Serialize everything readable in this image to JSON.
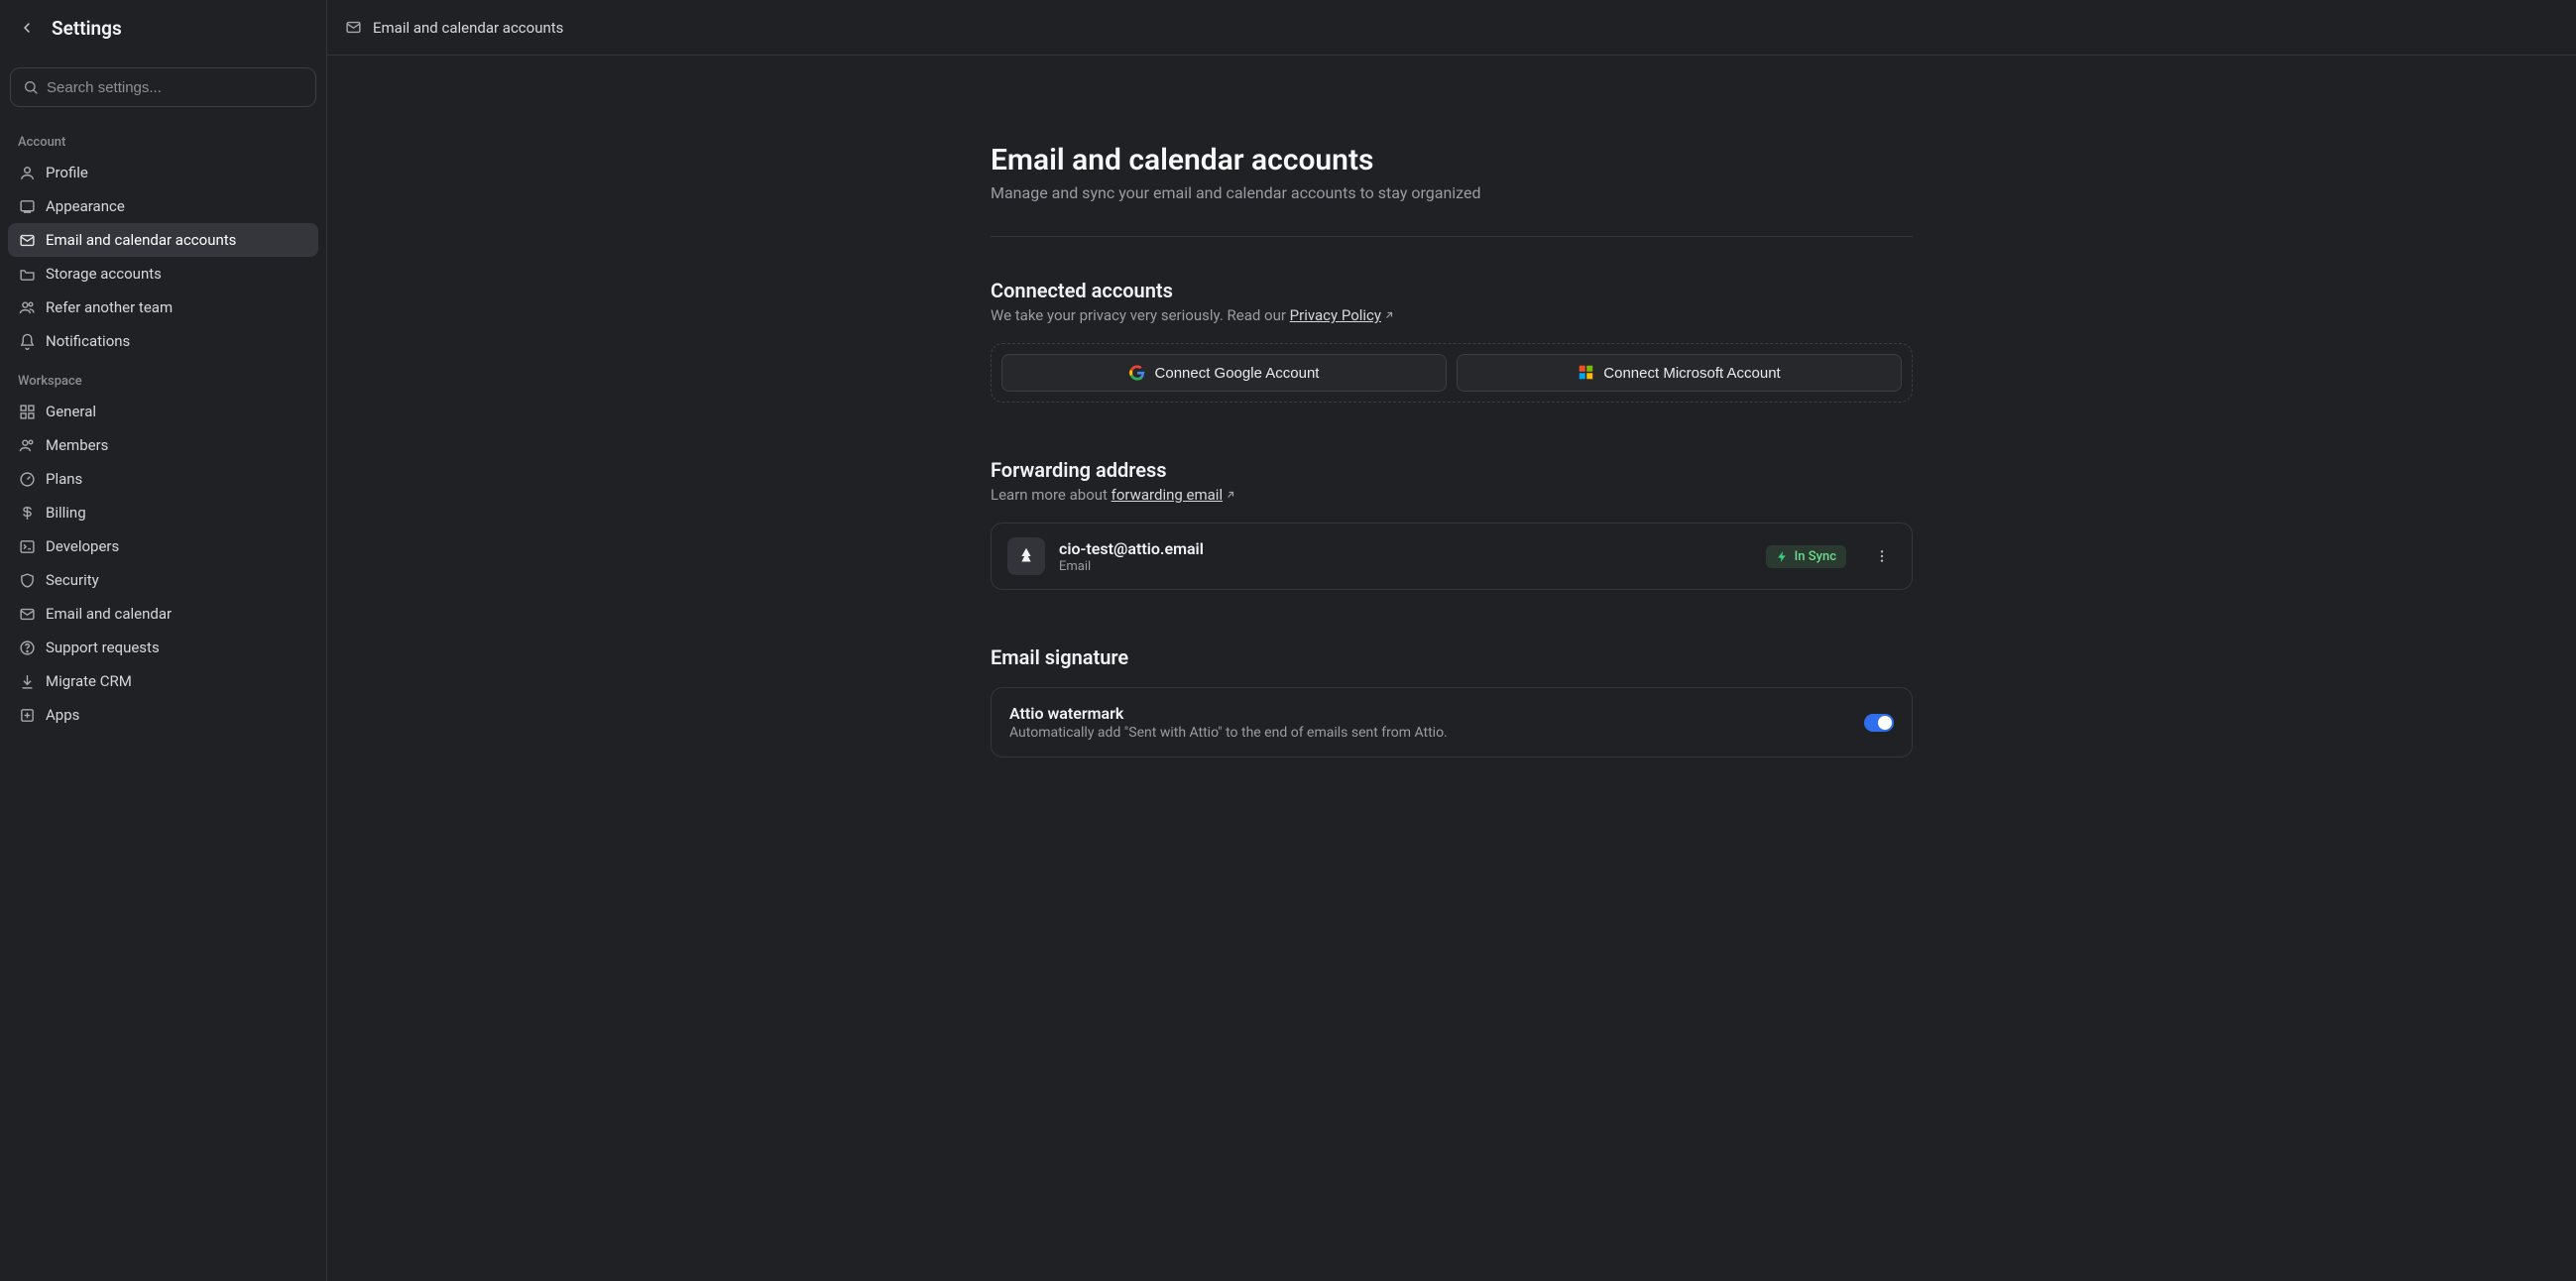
{
  "header": {
    "title": "Settings"
  },
  "search": {
    "placeholder": "Search settings..."
  },
  "sidebar": {
    "account_label": "Account",
    "workspace_label": "Workspace",
    "account": [
      {
        "label": "Profile"
      },
      {
        "label": "Appearance"
      },
      {
        "label": "Email and calendar accounts"
      },
      {
        "label": "Storage accounts"
      },
      {
        "label": "Refer another team"
      },
      {
        "label": "Notifications"
      }
    ],
    "workspace": [
      {
        "label": "General"
      },
      {
        "label": "Members"
      },
      {
        "label": "Plans"
      },
      {
        "label": "Billing"
      },
      {
        "label": "Developers"
      },
      {
        "label": "Security"
      },
      {
        "label": "Email and calendar"
      },
      {
        "label": "Support requests"
      },
      {
        "label": "Migrate CRM"
      },
      {
        "label": "Apps"
      }
    ]
  },
  "breadcrumb": {
    "label": "Email and calendar accounts"
  },
  "page": {
    "title": "Email and calendar accounts",
    "subtitle": "Manage and sync your email and calendar accounts to stay organized"
  },
  "connected": {
    "title": "Connected accounts",
    "desc_prefix": "We take your privacy very seriously. Read our ",
    "privacy_link": "Privacy Policy",
    "google_btn": "Connect Google Account",
    "microsoft_btn": "Connect Microsoft Account"
  },
  "forwarding": {
    "title": "Forwarding address",
    "desc_prefix": "Learn more about ",
    "link": "forwarding email",
    "email": "cio-test@attio.email",
    "type": "Email",
    "badge": "In Sync"
  },
  "signature": {
    "title": "Email signature",
    "watermark_title": "Attio watermark",
    "watermark_desc": "Automatically add \"Sent with Attio\" to the end of emails sent from Attio."
  }
}
